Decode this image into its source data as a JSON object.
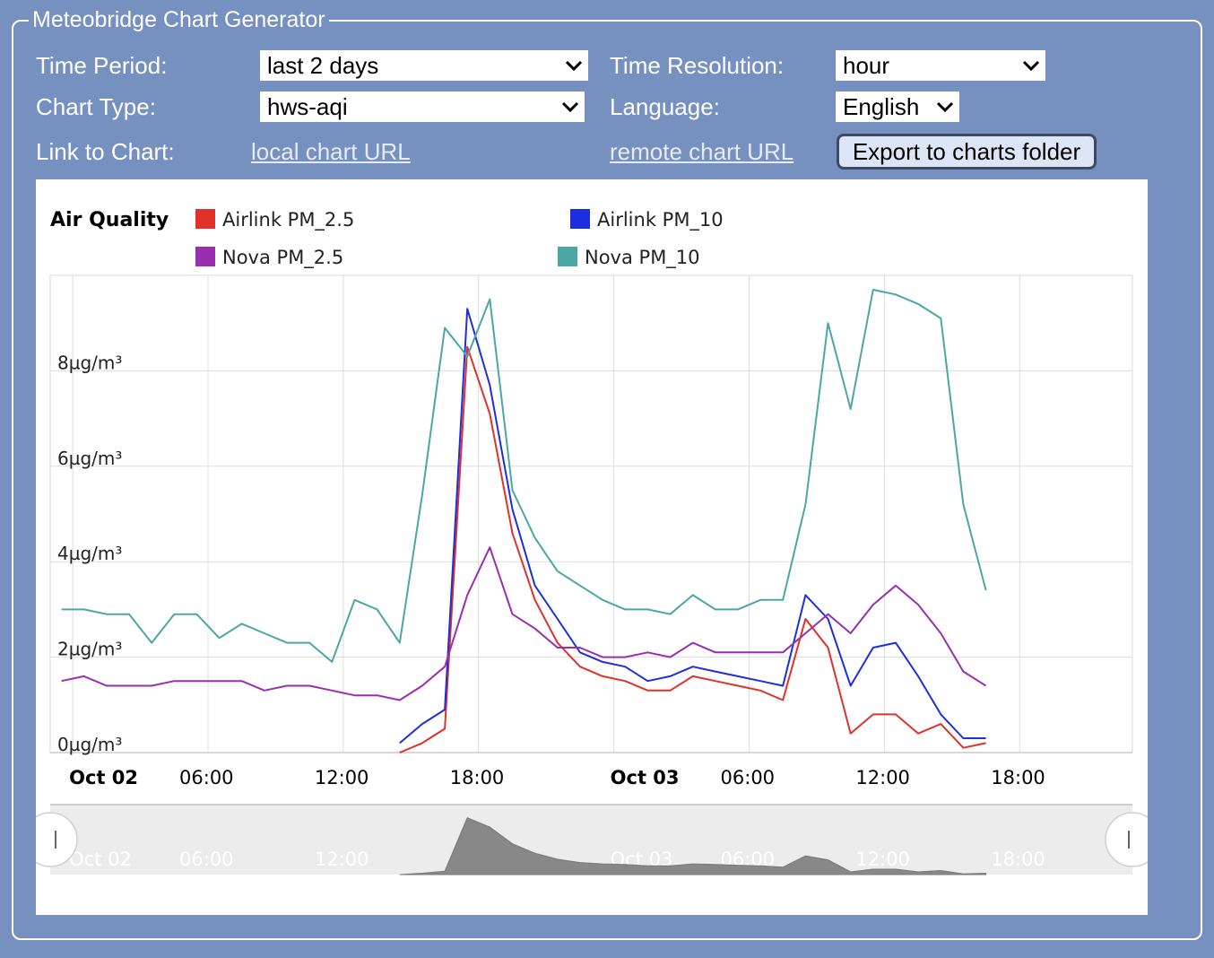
{
  "form": {
    "title": "Meteobridge Chart Generator",
    "time_period_label": "Time Period:",
    "time_period_value": "last 2 days",
    "time_resolution_label": "Time Resolution:",
    "time_resolution_value": "hour",
    "chart_type_label": "Chart Type:",
    "chart_type_value": "hws-aqi",
    "language_label": "Language:",
    "language_value": "English",
    "link_label": "Link to Chart:",
    "local_link": "local chart URL",
    "remote_link": "remote chart URL",
    "export_button": "Export to charts folder"
  },
  "colors": {
    "background": "#7690c0",
    "airlink_pm25": "#e0312b",
    "airlink_pm10": "#1c2ee0",
    "nova_pm25": "#9a2fae",
    "nova_pm10": "#4aa7a6",
    "navigator_fill": "#888888"
  },
  "chart_data": {
    "type": "line",
    "title": "Air Quality",
    "ylim": [
      0,
      10
    ],
    "yticks": [
      "0µg/m³",
      "2µg/m³",
      "4µg/m³",
      "6µg/m³",
      "8µg/m³"
    ],
    "ytick_values": [
      0,
      2,
      4,
      6,
      8
    ],
    "x_range_hours": [
      -1,
      47
    ],
    "xticks": [
      {
        "hour": 0,
        "label": "Oct 02",
        "bold": true
      },
      {
        "hour": 6,
        "label": "06:00",
        "bold": false
      },
      {
        "hour": 12,
        "label": "12:00",
        "bold": false
      },
      {
        "hour": 18,
        "label": "18:00",
        "bold": false
      },
      {
        "hour": 24,
        "label": "Oct 03",
        "bold": true
      },
      {
        "hour": 30,
        "label": "06:00",
        "bold": false
      },
      {
        "hour": 36,
        "label": "12:00",
        "bold": false
      },
      {
        "hour": 42,
        "label": "18:00",
        "bold": false
      }
    ],
    "grid": true,
    "legend": "top",
    "series": [
      {
        "name": "Airlink PM_2.5",
        "color_key": "airlink_pm25",
        "start_hour": 14.5,
        "values": [
          0.0,
          0.2,
          0.5,
          8.5,
          7.1,
          4.6,
          3.2,
          2.3,
          1.8,
          1.6,
          1.5,
          1.3,
          1.3,
          1.6,
          1.5,
          1.4,
          1.3,
          1.1,
          2.8,
          2.2,
          0.4,
          0.8,
          0.8,
          0.4,
          0.6,
          0.1,
          0.2
        ]
      },
      {
        "name": "Airlink PM_10",
        "color_key": "airlink_pm10",
        "start_hour": 14.5,
        "values": [
          0.2,
          0.6,
          0.9,
          9.3,
          7.7,
          5.1,
          3.5,
          2.8,
          2.1,
          1.9,
          1.8,
          1.5,
          1.6,
          1.8,
          1.7,
          1.6,
          1.5,
          1.4,
          3.3,
          2.8,
          1.4,
          2.2,
          2.3,
          1.6,
          0.8,
          0.3,
          0.3
        ]
      },
      {
        "name": "Nova PM_2.5",
        "color_key": "nova_pm25",
        "start_hour": -0.5,
        "values": [
          1.5,
          1.6,
          1.4,
          1.4,
          1.4,
          1.5,
          1.5,
          1.5,
          1.5,
          1.3,
          1.4,
          1.4,
          1.3,
          1.2,
          1.2,
          1.1,
          1.4,
          1.8,
          3.3,
          4.3,
          2.9,
          2.6,
          2.2,
          2.2,
          2.0,
          2.0,
          2.1,
          2.0,
          2.3,
          2.1,
          2.1,
          2.1,
          2.1,
          2.5,
          2.9,
          2.5,
          3.1,
          3.5,
          3.1,
          2.5,
          1.7,
          1.4
        ]
      },
      {
        "name": "Nova PM_10",
        "color_key": "nova_pm10",
        "start_hour": -0.5,
        "values": [
          3.0,
          3.0,
          2.9,
          2.9,
          2.3,
          2.9,
          2.9,
          2.4,
          2.7,
          2.5,
          2.3,
          2.3,
          1.9,
          3.2,
          3.0,
          2.3,
          5.4,
          8.9,
          8.3,
          9.5,
          5.5,
          4.5,
          3.8,
          3.5,
          3.2,
          3.0,
          3.0,
          2.9,
          3.3,
          3.0,
          3.0,
          3.2,
          3.2,
          5.2,
          9.0,
          7.2,
          9.7,
          9.6,
          9.4,
          9.1,
          5.2,
          3.4
        ]
      }
    ]
  }
}
